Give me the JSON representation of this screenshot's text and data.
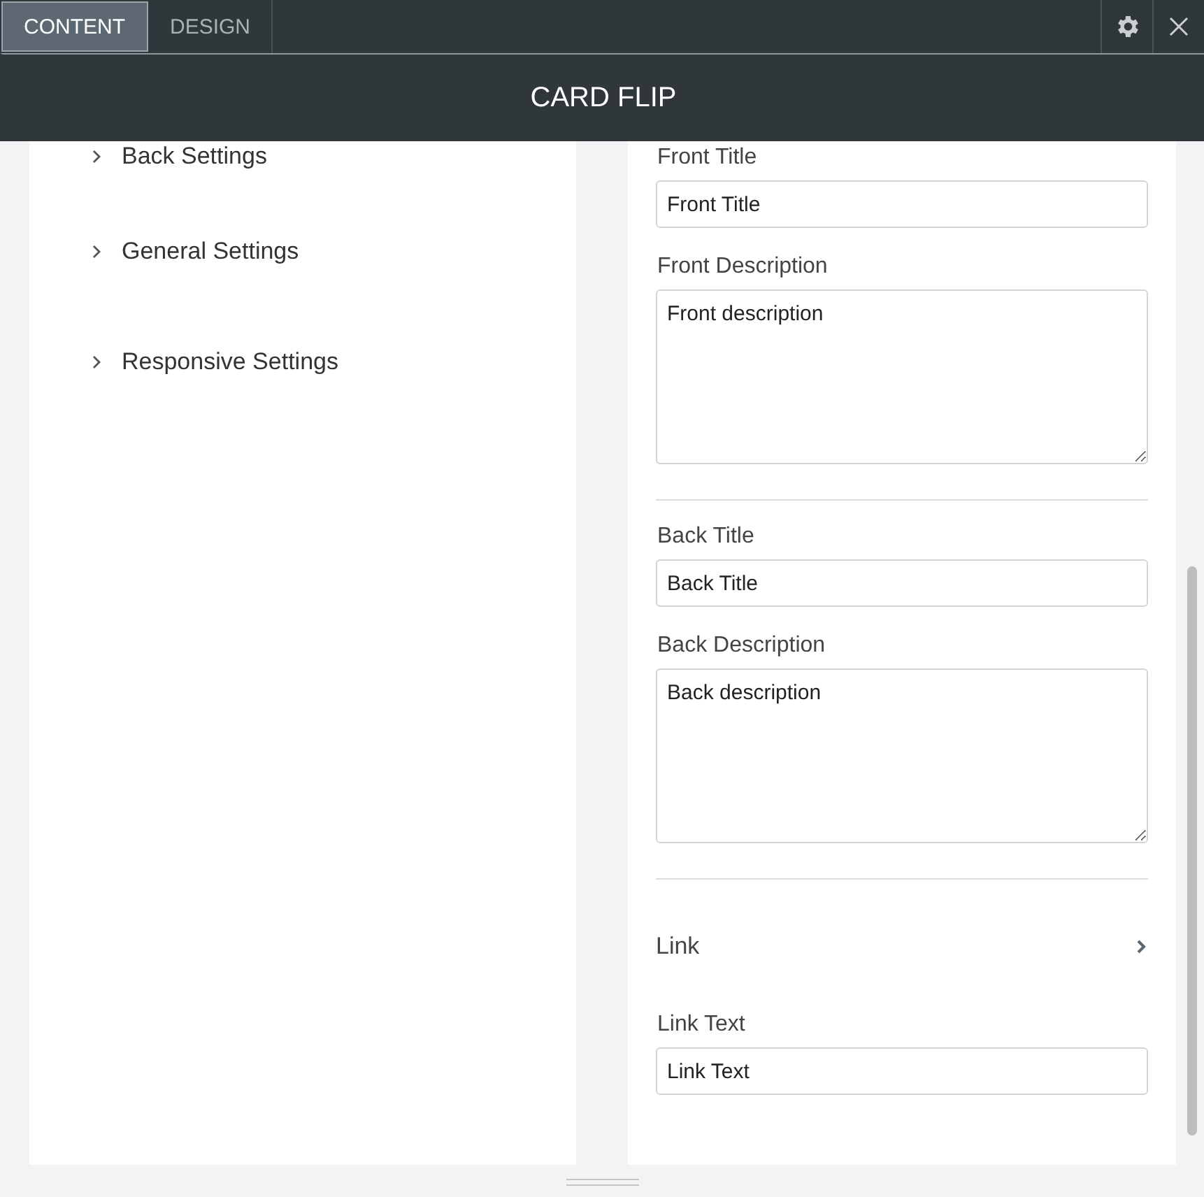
{
  "tabs": [
    {
      "label": "CONTENT",
      "selected": true
    },
    {
      "label": "DESIGN",
      "selected": false
    }
  ],
  "title": "CARD FLIP",
  "sections": [
    {
      "label": "Back Settings",
      "expanded": false
    },
    {
      "label": "General Settings",
      "expanded": false
    },
    {
      "label": "Responsive Settings",
      "expanded": false
    }
  ],
  "fields": [
    {
      "kind": "text",
      "label": "Front Title",
      "value": "Front Title"
    },
    {
      "kind": "textarea",
      "label": "Front Description",
      "value": "Front description"
    },
    {
      "kind": "divider"
    },
    {
      "kind": "text",
      "label": "Back Title",
      "value": "Back Title"
    },
    {
      "kind": "textarea",
      "label": "Back Description",
      "value": "Back description"
    },
    {
      "kind": "divider"
    },
    {
      "kind": "link",
      "label": "Link"
    },
    {
      "kind": "text",
      "label": "Link Text",
      "value": "Link Text"
    }
  ]
}
